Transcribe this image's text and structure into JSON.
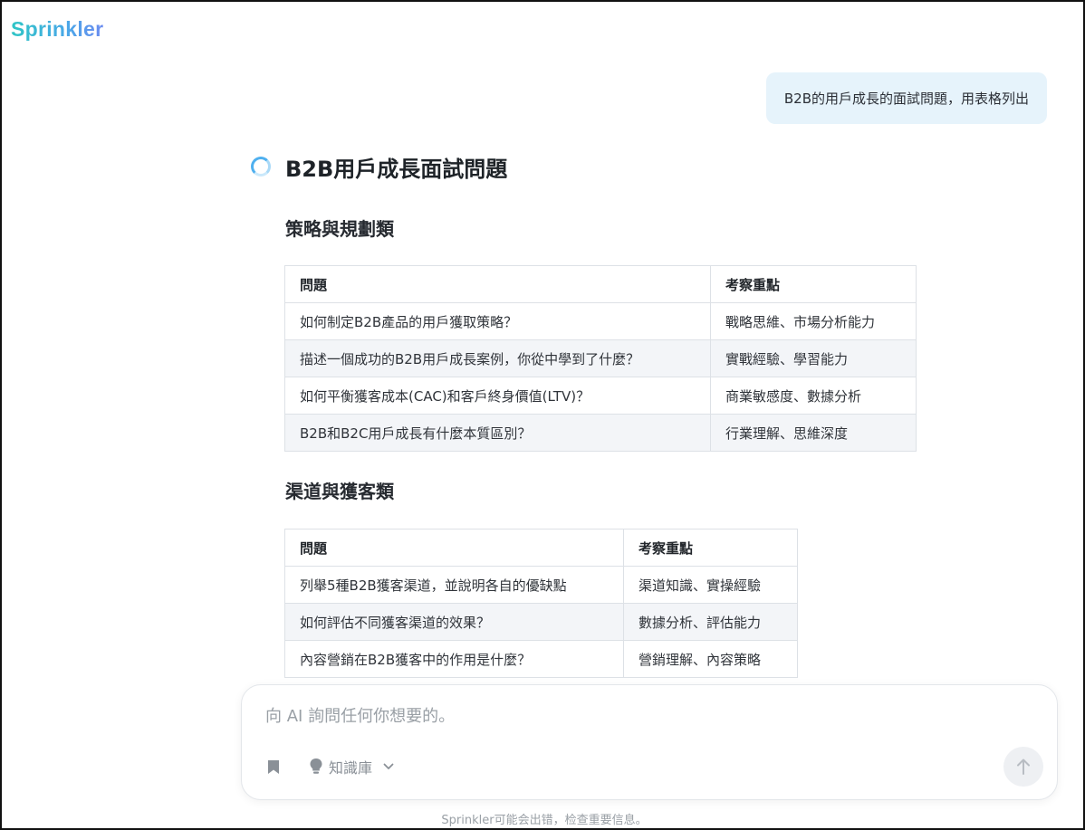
{
  "app": {
    "logo": "Sprinkler"
  },
  "user_message": {
    "text": "B2B的用戶成長的面試問題，用表格列出"
  },
  "answer": {
    "title": "B2B用戶成長面試問題",
    "sections": [
      {
        "title": "策略與規劃類",
        "headers": [
          "問題",
          "考察重點"
        ],
        "rows": [
          [
            "如何制定B2B產品的用戶獲取策略？",
            "戰略思維、市場分析能力"
          ],
          [
            "描述一個成功的B2B用戶成長案例，你從中學到了什麼？",
            "實戰經驗、學習能力"
          ],
          [
            "如何平衡獲客成本(CAC)和客戶終身價值(LTV)？",
            "商業敏感度、數據分析"
          ],
          [
            "B2B和B2C用戶成長有什麼本質區別？",
            "行業理解、思維深度"
          ]
        ]
      },
      {
        "title": "渠道與獲客類",
        "headers": [
          "問題",
          "考察重點"
        ],
        "rows": [
          [
            "列舉5種B2B獲客渠道，並說明各自的優缺點",
            "渠道知識、實操經驗"
          ],
          [
            "如何評估不同獲客渠道的效果？",
            "數據分析、評估能力"
          ],
          [
            "內容營銷在B2B獲客中的作用是什麼？",
            "營銷理解、內容策略"
          ]
        ]
      }
    ]
  },
  "composer": {
    "placeholder": "向 AI 詢問任何你想要的。",
    "knowledge_base_label": "知識庫",
    "bookmark_icon": "bookmark-icon",
    "bulb_icon": "lightbulb-icon",
    "chevron_icon": "chevron-down-icon",
    "send_icon": "arrow-up-icon"
  },
  "disclaimer": "Sprinkler可能会出错，检查重要信息。",
  "colors": {
    "accent_teal": "#2ec5c5",
    "accent_blue": "#4aa8e8",
    "user_bubble_bg": "#e6f3fb",
    "table_alt_row": "#f3f5f8"
  }
}
